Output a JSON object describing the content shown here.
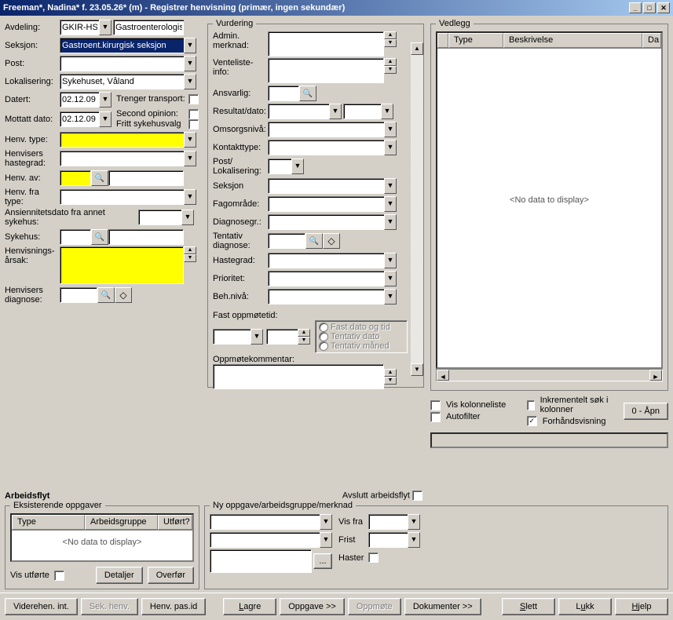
{
  "titlebar": "Freeman*, Nadina* f. 23.05.26* (m) - Registrer henvisning (primær, ingen sekundær)",
  "left": {
    "lbl_avdeling": "Avdeling:",
    "avdeling": "GKIR-HS",
    "avdeling_full": "Gastroenterologisk kir",
    "lbl_seksjon": "Seksjon:",
    "seksjon": "Gastroent.kirurgisk seksjon",
    "lbl_post": "Post:",
    "lbl_lokalisering": "Lokalisering:",
    "lokalisering": "Sykehuset, Våland",
    "lbl_datert": "Datert:",
    "datert": "02.12.09",
    "lbl_mottatt": "Mottatt dato:",
    "mottatt": "02.12.09",
    "chk_transport": "Trenger transport:",
    "chk_second": "Second opinion:",
    "chk_fritt": "Fritt sykehusvalg",
    "lbl_henvtype": "Henv. type:",
    "lbl_hastegrad": "Henvisers hastegrad:",
    "lbl_henvav": "Henv. av:",
    "lbl_henvfratype": "Henv. fra type:",
    "lbl_ansien": "Ansiennitetsdato fra annet sykehus:",
    "lbl_sykehus": "Sykehus:",
    "lbl_arsak": "Henvisnings-årsak:",
    "lbl_diagnose": "Henvisers diagnose:"
  },
  "vurdering": {
    "legend": "Vurdering",
    "lbl_admin": "Admin. merknad:",
    "lbl_vente": "Venteliste-info:",
    "lbl_ansvarlig": "Ansvarlig:",
    "lbl_resultat": "Resultat/dato:",
    "lbl_omsorg": "Omsorgsnivå:",
    "lbl_kontakt": "Kontakttype:",
    "lbl_postlok": "Post/\nLokalisering:",
    "lbl_post": "Post/",
    "lbl_lokalisering2": "Lokalisering:",
    "lbl_seksjon": "Seksjon",
    "lbl_fagomrade": "Fagområde:",
    "lbl_diagnosegr": "Diagnosegr.:",
    "lbl_tentativ": "Tentativ diagnose:",
    "lbl_hastegrad": "Hastegrad:",
    "lbl_prioritet": "Prioritet:",
    "lbl_behniva": "Beh.nivå:",
    "lbl_fastopp": "Fast oppmøtetid:",
    "lbl_oppkommentar": "Oppmøtekommentar:",
    "opt_fastdato": "Fast dato og tid",
    "opt_tentdato": "Tentativ dato",
    "opt_tentmaned": "Tentativ måned"
  },
  "vedlegg": {
    "legend": "Vedlegg",
    "col_type": "Type",
    "col_beskr": "Beskrivelse",
    "col_da": "Da",
    "empty": "<No data to display>",
    "chk_kolonne": "Vis kolonneliste",
    "chk_inkrement": "Inkrementelt søk i kolonner",
    "chk_autofilter": "Autofilter",
    "chk_forhands": "Forhåndsvisning",
    "btn_apn": "0 - Åpn"
  },
  "arbeidsflyt": {
    "legend": "Arbeidsflyt",
    "avslutt": "Avslutt arbeidsflyt",
    "eksisterende": "Eksisterende oppgaver",
    "col_type": "Type",
    "col_arbeids": "Arbeidsgruppe",
    "col_utfort": "Utført?",
    "empty": "<No data to display>",
    "vis_utforte": "Vis utførte",
    "btn_detaljer": "Detaljer",
    "btn_overfor": "Overfør",
    "ny_legend": "Ny oppgave/arbeidsgruppe/merknad",
    "lbl_visfra": "Vis fra",
    "lbl_frist": "Frist",
    "lbl_haster": "Haster"
  },
  "toolbar": {
    "viderehen": "Viderehen. int.",
    "sek": "Sek. henv.",
    "henvpas": "Henv. pas.id",
    "lagre": "Lagre",
    "oppgave": "Oppgave >>",
    "oppmote": "Oppmøte",
    "dokumenter": "Dokumenter >>",
    "slett": "Slett",
    "lukk": "Lukk",
    "hjelp": "Hjelp"
  }
}
